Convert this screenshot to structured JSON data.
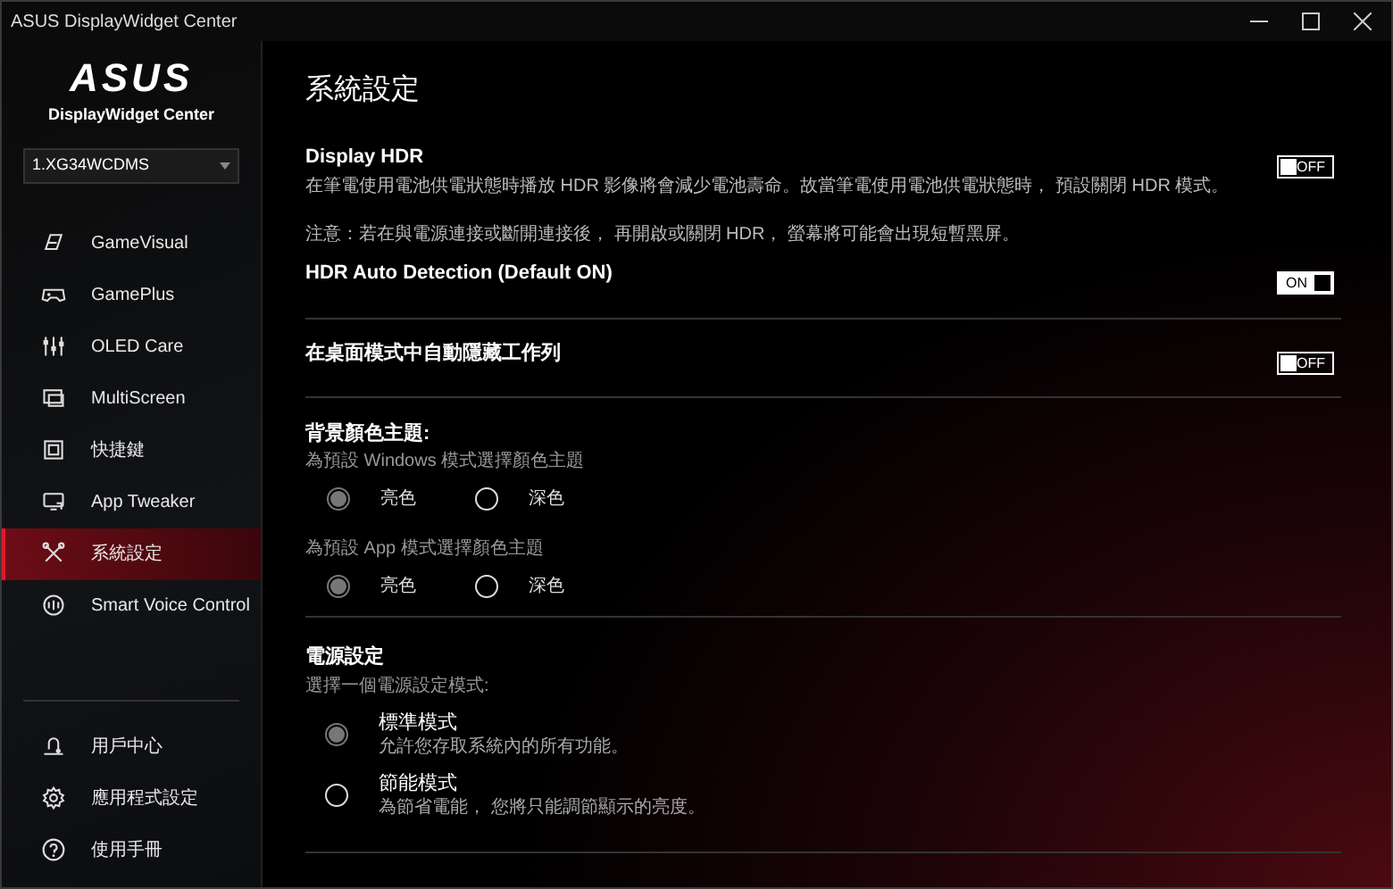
{
  "window": {
    "title": "ASUS DisplayWidget Center"
  },
  "sidebar": {
    "logo": "ASUS",
    "app_name": "DisplayWidget Center",
    "device_select": {
      "value": "1.XG34WCDMS"
    },
    "nav_items": [
      {
        "label": "GameVisual",
        "selected": false
      },
      {
        "label": "GamePlus",
        "selected": false
      },
      {
        "label": "OLED Care",
        "selected": false
      },
      {
        "label": "MultiScreen",
        "selected": false
      },
      {
        "label": "快捷鍵",
        "selected": false
      },
      {
        "label": "App Tweaker",
        "selected": false
      },
      {
        "label": "系統設定",
        "selected": true
      },
      {
        "label": "Smart Voice Control",
        "selected": false
      }
    ],
    "footer_items": [
      {
        "label": "用戶中心"
      },
      {
        "label": "應用程式設定"
      },
      {
        "label": "使用手冊"
      }
    ]
  },
  "main": {
    "title": "系統設定",
    "sections": [
      {
        "kind": "toggles",
        "settings": [
          {
            "title": "Display HDR",
            "description": "在筆電使用電池供電狀態時播放 HDR 影像將會減少電池壽命。故當筆電使用電池供電狀態時， 預設關閉 HDR 模式。",
            "note": "注意：若在與電源連接或斷開連接後， 再開啟或關閉 HDR， 螢幕將可能會出現短暫黑屏。",
            "switch": {
              "on": false,
              "label": "OFF"
            }
          },
          {
            "title": "HDR Auto Detection (Default ON)",
            "switch": {
              "on": true,
              "label": "ON"
            }
          }
        ]
      },
      {
        "kind": "toggles",
        "settings": [
          {
            "title": "在桌面模式中自動隱藏工作列",
            "switch": {
              "on": false,
              "label": "OFF"
            }
          }
        ]
      },
      {
        "kind": "themes",
        "title": "背景顏色主題:",
        "groups": [
          {
            "caption": "為預設 Windows 模式選擇顏色主題",
            "options": [
              {
                "label": "亮色",
                "selected": true
              },
              {
                "label": "深色",
                "selected": false
              }
            ]
          },
          {
            "caption": "為預設 App 模式選擇顏色主題",
            "options": [
              {
                "label": "亮色",
                "selected": true
              },
              {
                "label": "深色",
                "selected": false
              }
            ]
          }
        ]
      },
      {
        "kind": "power",
        "title": "電源設定",
        "caption": "選擇一個電源設定模式:",
        "options": [
          {
            "label": "標準模式",
            "description": "允許您存取系統內的所有功能。",
            "selected": true
          },
          {
            "label": "節能模式",
            "description": "為節省電能， 您將只能調節顯示的亮度。",
            "selected": false
          }
        ]
      }
    ]
  }
}
